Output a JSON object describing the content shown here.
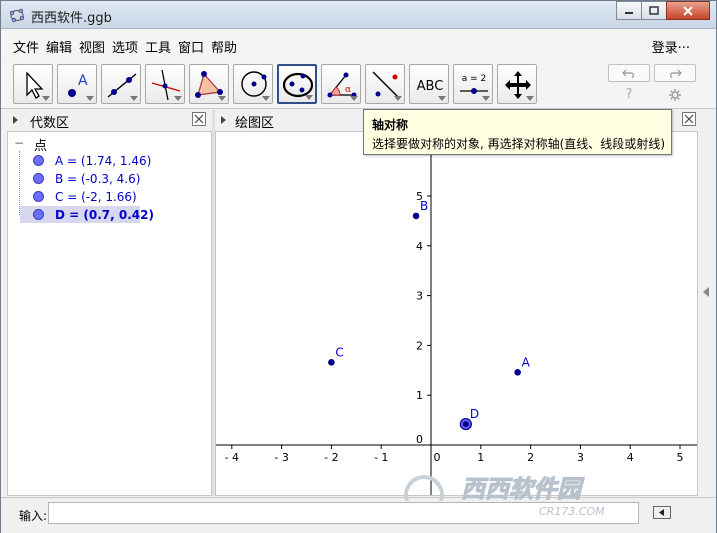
{
  "window": {
    "title": "西西软件.ggb"
  },
  "menu": [
    "文件",
    "编辑",
    "视图",
    "选项",
    "工具",
    "窗口",
    "帮助"
  ],
  "login_label": "登录···",
  "toolbar": {
    "tools": [
      {
        "name": "move-tool",
        "active": false
      },
      {
        "name": "point-tool",
        "active": false
      },
      {
        "name": "line-tool",
        "active": false
      },
      {
        "name": "perpendicular-line-tool",
        "active": false
      },
      {
        "name": "polygon-tool",
        "active": false
      },
      {
        "name": "circle-tool",
        "active": false
      },
      {
        "name": "conic-tool",
        "active": true
      },
      {
        "name": "angle-tool",
        "active": false
      },
      {
        "name": "reflect-about-line-tool",
        "active": false
      },
      {
        "name": "text-tool",
        "active": false
      },
      {
        "name": "slider-tool",
        "active": false
      },
      {
        "name": "move-graphics-view-tool",
        "active": false
      }
    ],
    "text_tool_label": "ABC",
    "slider_tool_label": "a = 2",
    "help_label": "?",
    "settings_icon": "gear-icon"
  },
  "algebra_panel": {
    "title": "代数区",
    "group_label": "点",
    "items": [
      {
        "text": "A = (1.74, 1.46)",
        "selected": false
      },
      {
        "text": "B = (-0.3, 4.6)",
        "selected": false
      },
      {
        "text": "C = (-2, 1.66)",
        "selected": false
      },
      {
        "text": "D = (0.7, 0.42)",
        "selected": true
      }
    ]
  },
  "graphics_panel": {
    "title": "绘图区",
    "x_ticks": [
      "- 4",
      "- 3",
      "- 2",
      "- 1",
      "0",
      "1",
      "2",
      "3",
      "4",
      "5"
    ],
    "y_ticks": [
      "0",
      "1",
      "2",
      "3",
      "4",
      "5"
    ],
    "points": [
      {
        "label": "A",
        "x": 1.74,
        "y": 1.46
      },
      {
        "label": "B",
        "x": -0.3,
        "y": 4.6
      },
      {
        "label": "C",
        "x": -2,
        "y": 1.66
      },
      {
        "label": "D",
        "x": 0.7,
        "y": 0.42
      }
    ]
  },
  "tooltip": {
    "title": "轴对称",
    "body": "选择要做对称的对象, 再选择对称轴(直线、线段或射线)"
  },
  "input_bar": {
    "label": "输入:",
    "value": ""
  },
  "watermark": {
    "text": "西西软件园",
    "subtext": "CR173.COM"
  },
  "colors": {
    "point": "#00008b",
    "selected_point": "#6666ff",
    "label": "#0000cc"
  }
}
